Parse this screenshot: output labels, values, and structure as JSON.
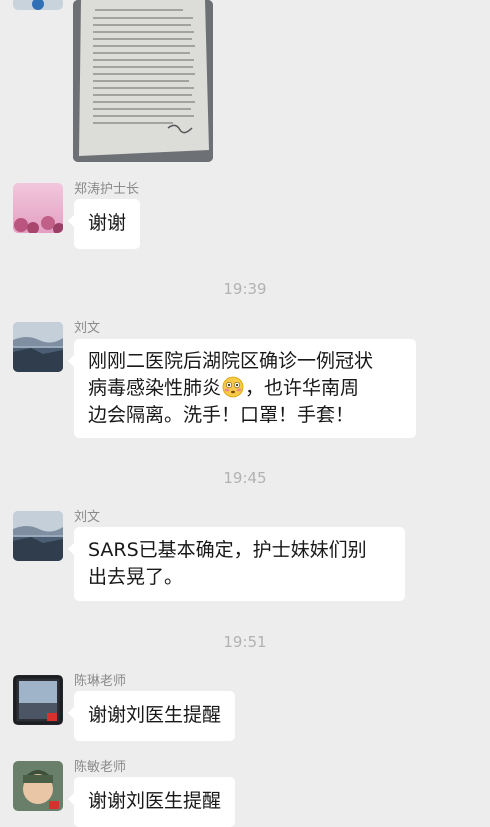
{
  "messages": [
    {
      "sender": "郑涛护士长",
      "text": "谢谢"
    },
    {
      "time": "19:39"
    },
    {
      "sender": "刘文",
      "line1": "刚刚二医院后湖院区确诊一例冠状",
      "line2a": "病毒感染性肺炎",
      "emoji": "flushed-face-emoji",
      "line2b": "，也许华南周",
      "line3": "边会隔离。洗手！口罩！手套！"
    },
    {
      "time": "19:45"
    },
    {
      "sender": "刘文",
      "text": "SARS已基本确定，护士妹妹们别\n出去晃了。"
    },
    {
      "time": "19:51"
    },
    {
      "sender": "陈琳老师",
      "text": "谢谢刘医生提醒"
    },
    {
      "sender": "陈敏老师",
      "text": "谢谢刘医生提醒"
    }
  ],
  "colors": {
    "background": "#ededed",
    "bubble": "#ffffff",
    "sender_name": "#8a8a8a",
    "timestamp": "#b2b2b2",
    "text": "#181818"
  }
}
